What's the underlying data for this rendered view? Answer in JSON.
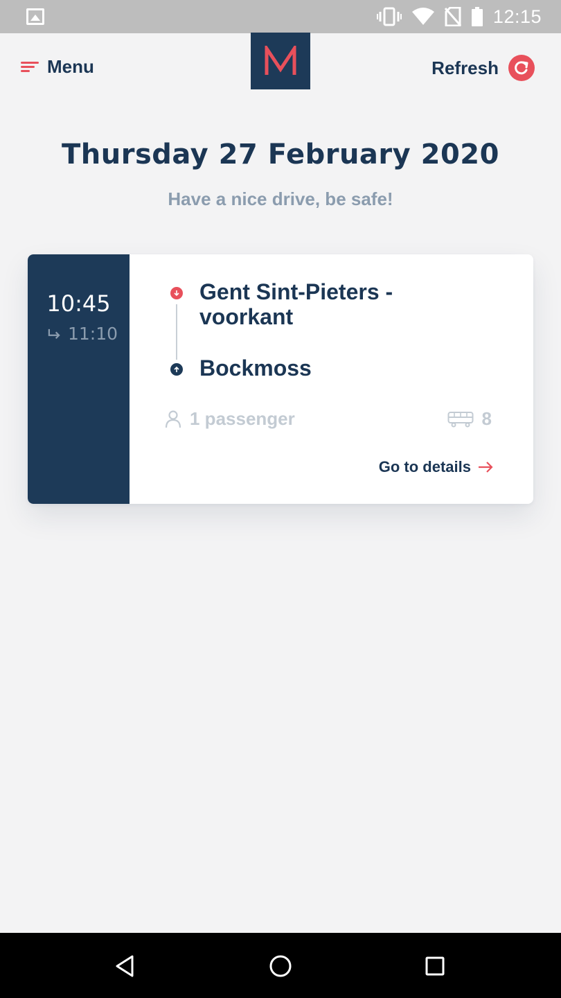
{
  "status_bar": {
    "time": "12:15",
    "icons": [
      "image-icon",
      "vibrate-icon",
      "wifi-icon",
      "no-sim-icon",
      "battery-icon"
    ]
  },
  "header": {
    "menu_label": "Menu",
    "logo_letter": "M",
    "refresh_label": "Refresh"
  },
  "main": {
    "date_title": "Thursday 27 February 2020",
    "subtitle": "Have a nice drive, be safe!"
  },
  "ride": {
    "depart_time": "10:45",
    "arrive_time": "11:10",
    "from": "Gent Sint-Pieters - voorkant",
    "to": "Bockmoss",
    "passengers": "1 passenger",
    "vehicle_seats": "8",
    "details_label": "Go to details"
  },
  "colors": {
    "navy": "#1d3a58",
    "accent": "#e8505b",
    "muted": "#8b9cae",
    "background": "#f3f3f4"
  },
  "nav_bar": {
    "buttons": [
      "back-icon",
      "home-icon",
      "recents-icon"
    ]
  }
}
